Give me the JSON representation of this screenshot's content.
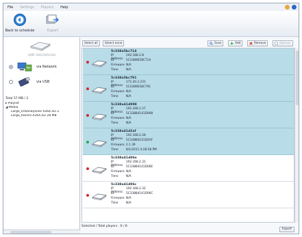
{
  "menu": {
    "file": "File",
    "settings": "Settings",
    "players": "Players",
    "help": "Help"
  },
  "toolbar": {
    "back_label": "Back to schedule",
    "export_label": "Export"
  },
  "left": {
    "device_model": "HMP 200/300/340",
    "network_label": "via Network",
    "usb_label": "via USB",
    "total": "Total 57 MB / 2",
    "tree": {
      "playlist": "Playlist",
      "media": "Media",
      "items": [
        "Largo_Indiana/jones h264.avi 2",
        "Largo_Racers.h264.avi 28 MB"
      ]
    }
  },
  "list_toolbar": {
    "select_all": "Select all",
    "select_none": "Select none",
    "scan": "Scan",
    "add": "Add",
    "remove": "Remove",
    "options": "Options"
  },
  "field_labels": {
    "ip": "IP Address",
    "id": "ID",
    "firmware": "Firmware",
    "time": "Time"
  },
  "players": [
    {
      "name": "5c338a5bc714",
      "ip": "192.168.2.8",
      "id": "5C3389E58C714",
      "firmware": "N/A",
      "time": "N/A",
      "status": "red",
      "selected": true
    },
    {
      "name": "5c338a5bc791",
      "ip": "172.20.2.231",
      "id": "5C3389E58C791",
      "firmware": "N/A",
      "time": "N/A",
      "status": "red",
      "selected": true
    },
    {
      "name": "5c338a41d098",
      "ip": "192.168.2.27",
      "id": "5C33884141D098",
      "firmware": "N/A",
      "time": "N/A",
      "status": "red",
      "selected": true
    },
    {
      "name": "5c338a41d2af",
      "ip": "192.168.2.28",
      "id": "5C33884141D2AF",
      "firmware": "2.1.39",
      "time": "8/1/2011 4:28:58 PM",
      "status": "green",
      "selected": true
    },
    {
      "name": "5c338a41d06e",
      "ip": "192.168.2.31",
      "id": "5C33884141D06E",
      "firmware": "N/A",
      "time": "N/A",
      "status": "red",
      "selected": false
    },
    {
      "name": "5c338a41d06c",
      "ip": "192.168.2.32",
      "id": "5C33884141D06C",
      "firmware": "N/A",
      "time": "N/A",
      "status": "red",
      "selected": false
    }
  ],
  "status": "Selected / Total players : 6 / 8",
  "export_button": "Export",
  "colors": {
    "selected_row": "#b8dce8",
    "status_red": "#d42a2a",
    "status_green": "#2aa84a",
    "accent": "#2a6ac8"
  }
}
